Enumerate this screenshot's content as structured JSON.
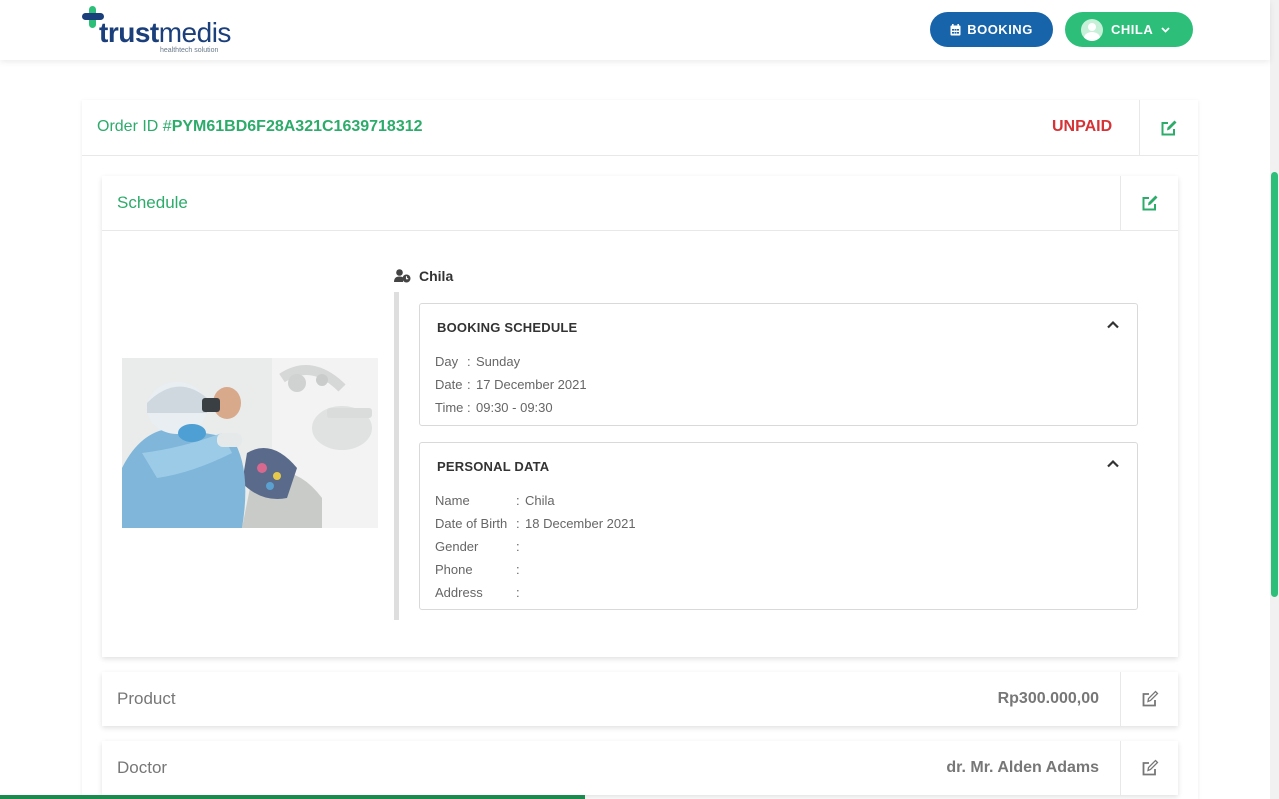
{
  "header": {
    "logo": {
      "text_bold": "trust",
      "text_light": "medis",
      "tagline": "healthtech solution"
    },
    "booking_label": "BOOKING",
    "user_label": "CHILA",
    "colors": {
      "booking": "#1864ab",
      "user": "#2dbf7a"
    }
  },
  "order": {
    "id_label": "Order ID #",
    "id_value": "PYM61BD6F28A321C1639718312",
    "status": "UNPAID",
    "status_color": "#d63336"
  },
  "schedule": {
    "title": "Schedule",
    "patient_name": "Chila",
    "booking_schedule": {
      "title": "BOOKING SCHEDULE",
      "rows": [
        {
          "key": "Day",
          "sep": ":",
          "value": "Sunday"
        },
        {
          "key": "Date",
          "sep": ":",
          "value": "17 December 2021"
        },
        {
          "key": "Time",
          "sep": ":",
          "value": "09:30 - 09:30"
        }
      ]
    },
    "personal_data": {
      "title": "PERSONAL DATA",
      "rows": [
        {
          "key": "Name",
          "sep": ":",
          "value": "Chila"
        },
        {
          "key": "Date of Birth",
          "sep": ":",
          "value": "18 December 2021"
        },
        {
          "key": "Gender",
          "sep": ":",
          "value": ""
        },
        {
          "key": "Phone",
          "sep": ":",
          "value": ""
        },
        {
          "key": "Address",
          "sep": ":",
          "value": ""
        }
      ]
    }
  },
  "product": {
    "title": "Product",
    "value": "Rp300.000,00"
  },
  "doctor": {
    "title": "Doctor",
    "value": "dr. Mr. Alden Adams"
  },
  "accent_color": "#2dab6b"
}
